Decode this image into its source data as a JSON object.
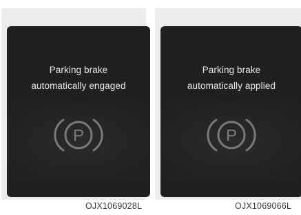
{
  "figures": [
    {
      "message_line1": "Parking brake",
      "message_line2": "automatically engaged",
      "icon": "parking-brake-icon",
      "caption": "OJX1069028L"
    },
    {
      "message_line1": "Parking brake",
      "message_line2": "automatically applied",
      "icon": "parking-brake-icon",
      "caption": "OJX1069066L"
    }
  ],
  "icon_letter": "P",
  "colors": {
    "screen": "#202020",
    "text": "#e9e9e9",
    "icon": "#7a7a7a",
    "panel": "#ececec"
  }
}
